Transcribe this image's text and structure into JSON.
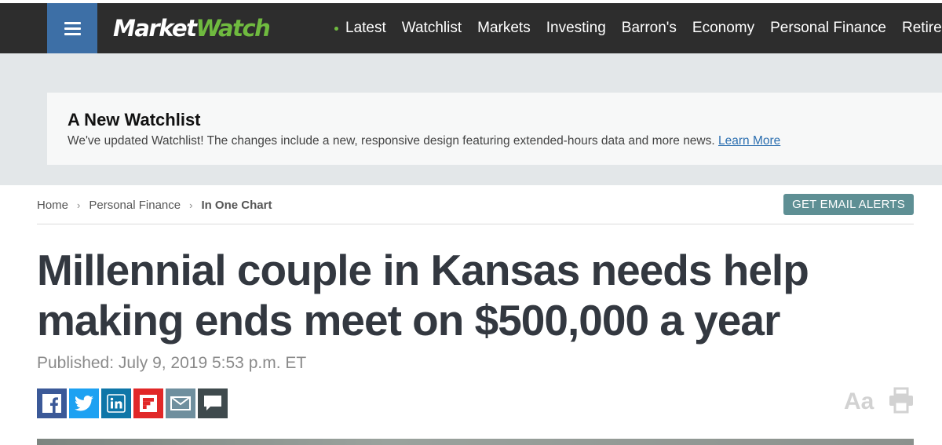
{
  "header": {
    "logo_part1": "Market",
    "logo_part2": "Watch",
    "nav_items": [
      "Latest",
      "Watchlist",
      "Markets",
      "Investing",
      "Barron's",
      "Economy",
      "Personal Finance",
      "Retirement"
    ]
  },
  "notice": {
    "title": "A New Watchlist",
    "text": "We've updated Watchlist! The changes include a new, responsive design featuring extended-hours data and more news.",
    "link": "Learn More"
  },
  "breadcrumb": {
    "items": [
      "Home",
      "Personal Finance",
      "In One Chart"
    ],
    "separator": "›"
  },
  "alerts_button": "GET EMAIL ALERTS",
  "article": {
    "headline_line1": "Millennial couple in Kansas needs help",
    "headline_line2": "making ends meet on $500,000 a year",
    "published": "Published: July 9, 2019 5:53 p.m. ET"
  },
  "share_buttons": [
    {
      "name": "facebook",
      "icon": "facebook-icon",
      "color": "#3b5998"
    },
    {
      "name": "twitter",
      "icon": "twitter-icon",
      "color": "#1da1f2"
    },
    {
      "name": "linkedin",
      "icon": "linkedin-icon",
      "color": "#0e76a8"
    },
    {
      "name": "flipboard",
      "icon": "flipboard-icon",
      "color": "#e12828"
    },
    {
      "name": "email",
      "icon": "email-icon",
      "color": "#6f8f9e"
    },
    {
      "name": "comments",
      "icon": "comment-icon",
      "color": "#3f4a4d"
    }
  ],
  "text_size_label": "Aa",
  "colors": {
    "nav_bg": "#2d2d2d",
    "menu_btn": "#3d6fa6",
    "logo_accent": "#6fba3f",
    "alerts_btn": "#5e8f94",
    "headline": "#333840"
  }
}
